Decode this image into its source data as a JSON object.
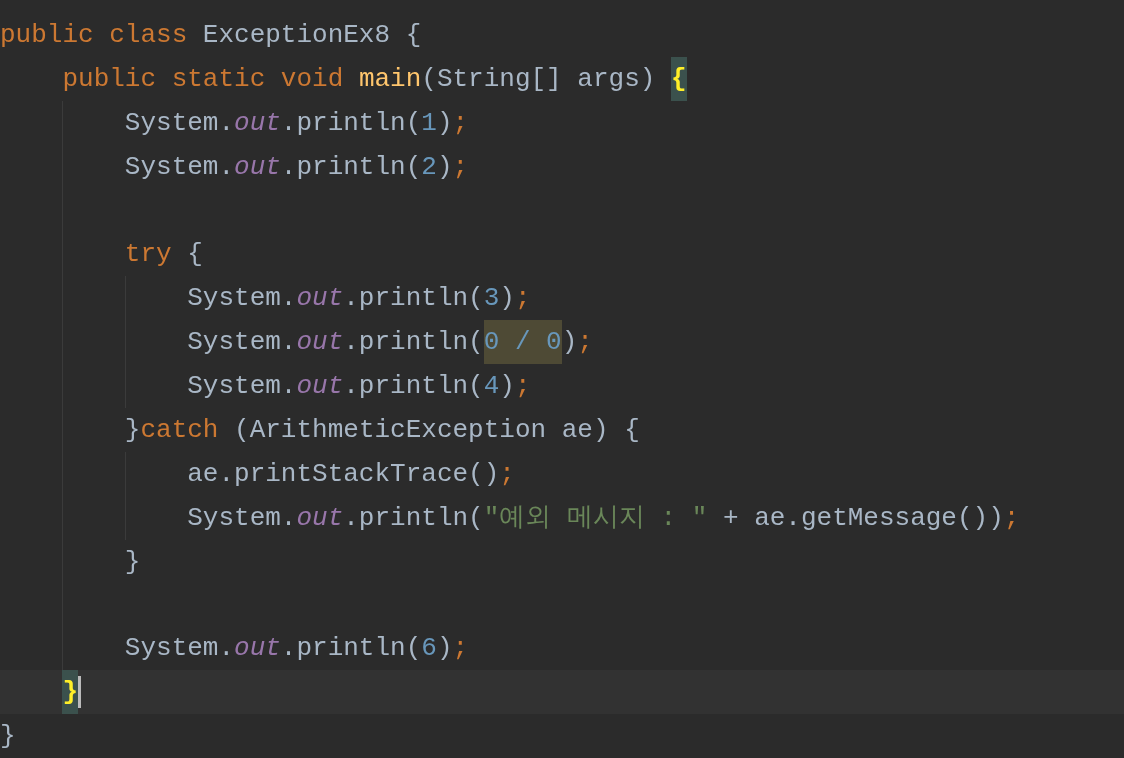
{
  "editor": {
    "lines": [
      {
        "current": false,
        "tokens": [
          {
            "t": "public class ",
            "kind": "keyword"
          },
          {
            "t": "ExceptionEx8 {",
            "kind": "plain"
          }
        ]
      },
      {
        "current": false,
        "tokens": [
          {
            "t": "    public static void ",
            "kind": "keyword"
          },
          {
            "t": "main",
            "kind": "method"
          },
          {
            "t": "(String[] args) ",
            "kind": "plain"
          },
          {
            "t": "{",
            "kind": "brace-match"
          }
        ]
      },
      {
        "current": false,
        "tokens": [
          {
            "t": "        System.",
            "kind": "plain"
          },
          {
            "t": "out",
            "kind": "field"
          },
          {
            "t": ".println(",
            "kind": "plain"
          },
          {
            "t": "1",
            "kind": "number"
          },
          {
            "t": ")",
            "kind": "plain"
          },
          {
            "t": ";",
            "kind": "keyword"
          }
        ]
      },
      {
        "current": false,
        "tokens": [
          {
            "t": "        System.",
            "kind": "plain"
          },
          {
            "t": "out",
            "kind": "field"
          },
          {
            "t": ".println(",
            "kind": "plain"
          },
          {
            "t": "2",
            "kind": "number"
          },
          {
            "t": ")",
            "kind": "plain"
          },
          {
            "t": ";",
            "kind": "keyword"
          }
        ]
      },
      {
        "current": false
      },
      {
        "current": false,
        "tokens": [
          {
            "t": "        try ",
            "kind": "keyword"
          },
          {
            "t": "{",
            "kind": "plain"
          }
        ]
      },
      {
        "current": false,
        "tokens": [
          {
            "t": "            System.",
            "kind": "plain"
          },
          {
            "t": "out",
            "kind": "field"
          },
          {
            "t": ".println(",
            "kind": "plain"
          },
          {
            "t": "3",
            "kind": "number"
          },
          {
            "t": ")",
            "kind": "plain"
          },
          {
            "t": ";",
            "kind": "keyword"
          }
        ]
      },
      {
        "current": false,
        "tokens": [
          {
            "t": "            System.",
            "kind": "plain"
          },
          {
            "t": "out",
            "kind": "field"
          },
          {
            "t": ".println(",
            "kind": "plain"
          },
          {
            "t": "0 / 0",
            "kind": "usage-number"
          },
          {
            "t": ")",
            "kind": "plain"
          },
          {
            "t": ";",
            "kind": "keyword"
          }
        ]
      },
      {
        "current": false,
        "tokens": [
          {
            "t": "            System.",
            "kind": "plain"
          },
          {
            "t": "out",
            "kind": "field"
          },
          {
            "t": ".println(",
            "kind": "plain"
          },
          {
            "t": "4",
            "kind": "number"
          },
          {
            "t": ")",
            "kind": "plain"
          },
          {
            "t": ";",
            "kind": "keyword"
          }
        ]
      },
      {
        "current": false,
        "tokens": [
          {
            "t": "        }",
            "kind": "plain"
          },
          {
            "t": "catch ",
            "kind": "keyword"
          },
          {
            "t": "(ArithmeticException ae) {",
            "kind": "plain"
          }
        ]
      },
      {
        "current": false,
        "tokens": [
          {
            "t": "            ae.printStackTrace()",
            "kind": "plain"
          },
          {
            "t": ";",
            "kind": "keyword"
          }
        ]
      },
      {
        "current": false,
        "tokens": [
          {
            "t": "            System.",
            "kind": "plain"
          },
          {
            "t": "out",
            "kind": "field"
          },
          {
            "t": ".println(",
            "kind": "plain"
          },
          {
            "t": "\"예외 메시지 : \"",
            "kind": "string"
          },
          {
            "t": " + ae.getMessage())",
            "kind": "plain"
          },
          {
            "t": ";",
            "kind": "keyword"
          }
        ]
      },
      {
        "current": false,
        "tokens": [
          {
            "t": "        }",
            "kind": "plain"
          }
        ]
      },
      {
        "current": false
      },
      {
        "current": false,
        "tokens": [
          {
            "t": "        System.",
            "kind": "plain"
          },
          {
            "t": "out",
            "kind": "field"
          },
          {
            "t": ".println(",
            "kind": "plain"
          },
          {
            "t": "6",
            "kind": "number"
          },
          {
            "t": ")",
            "kind": "plain"
          },
          {
            "t": ";",
            "kind": "keyword"
          }
        ]
      },
      {
        "current": true,
        "tokens": [
          {
            "t": "    }",
            "kind": "brace-match"
          }
        ]
      },
      {
        "current": false,
        "tokens": [
          {
            "t": "}",
            "kind": "plain"
          }
        ]
      }
    ]
  }
}
